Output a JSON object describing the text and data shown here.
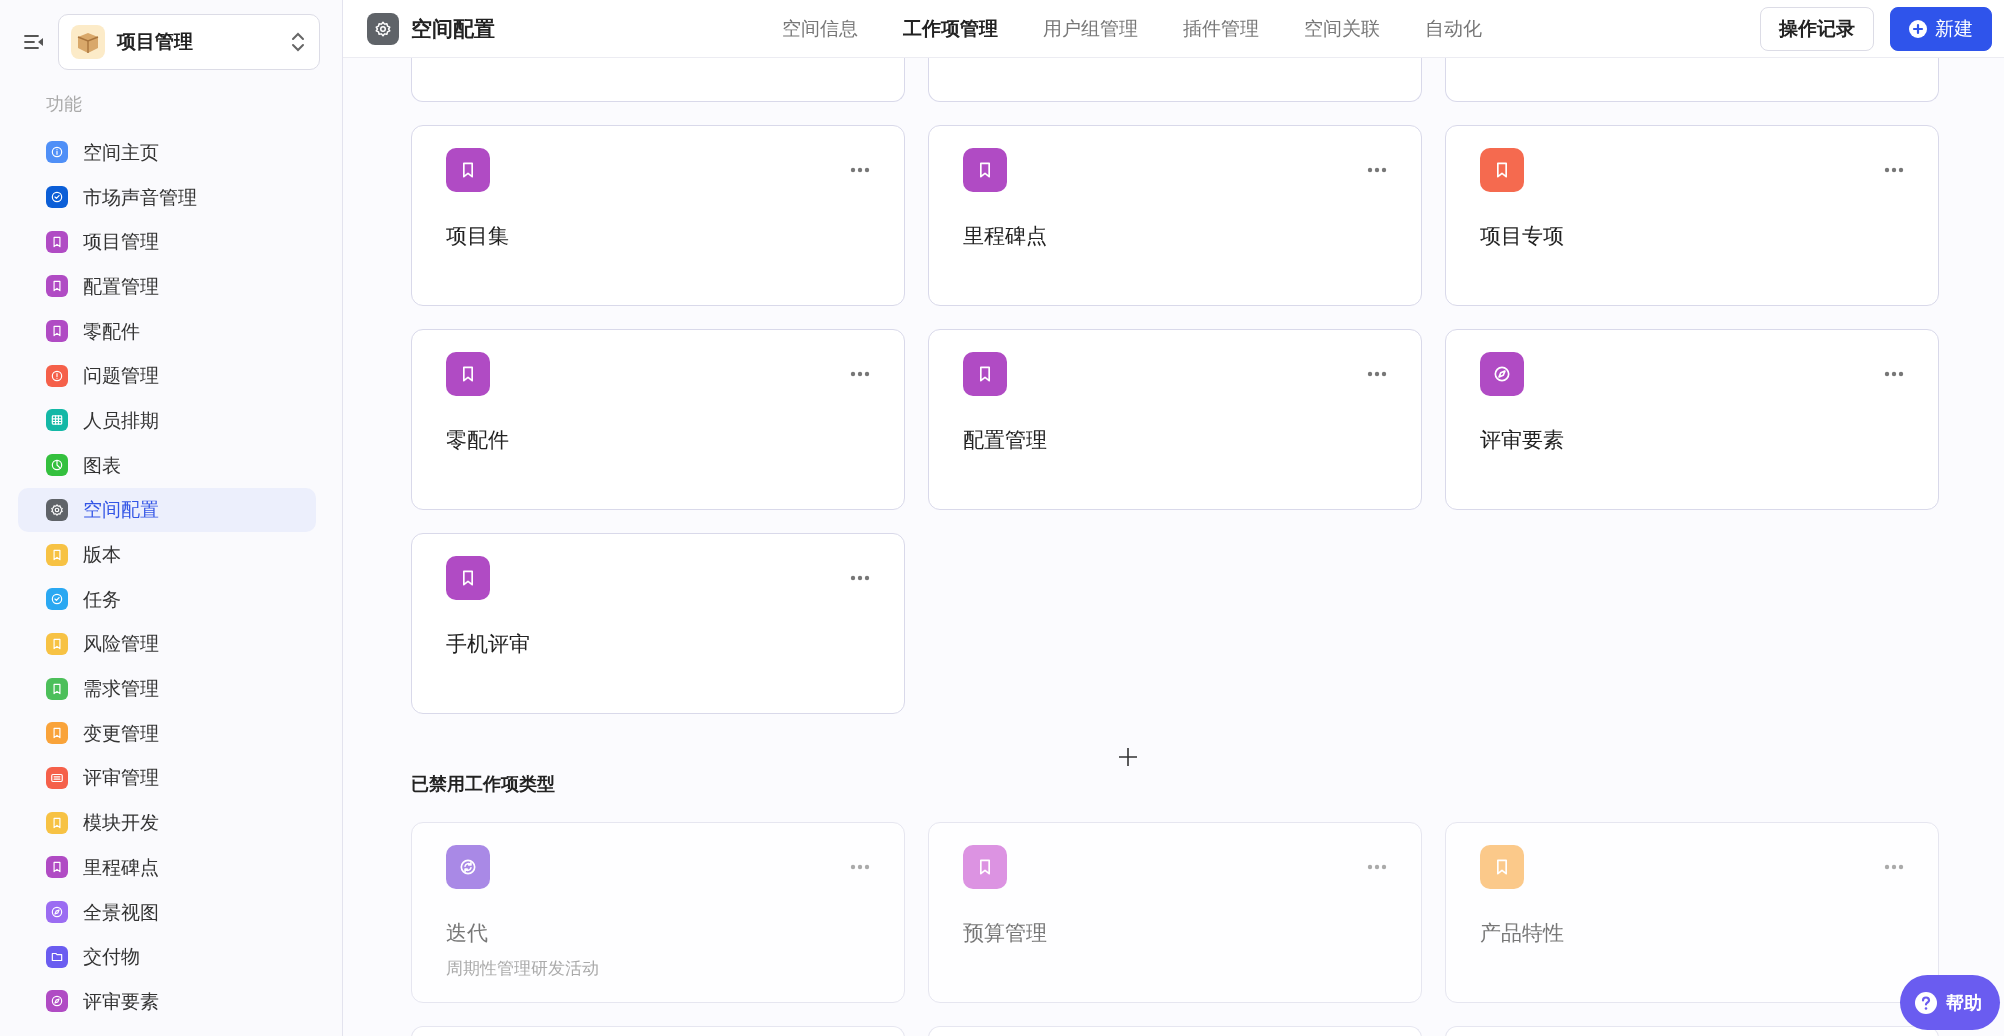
{
  "sidebar": {
    "space": {
      "name": "项目管理"
    },
    "section_label": "功能",
    "items": [
      {
        "label": "空间主页",
        "kind": "info",
        "color": "#4f8ff7",
        "selected": false
      },
      {
        "label": "市场声音管理",
        "kind": "check",
        "color": "#0b5ed7",
        "selected": false
      },
      {
        "label": "项目管理",
        "kind": "bookmark",
        "color": "#b04bc4",
        "selected": false
      },
      {
        "label": "配置管理",
        "kind": "bookmark",
        "color": "#b04bc4",
        "selected": false
      },
      {
        "label": "零配件",
        "kind": "bookmark",
        "color": "#b04bc4",
        "selected": false
      },
      {
        "label": "问题管理",
        "kind": "alert",
        "color": "#f5604a",
        "selected": false
      },
      {
        "label": "人员排期",
        "kind": "table",
        "color": "#14b8a6",
        "selected": false
      },
      {
        "label": "图表",
        "kind": "pie",
        "color": "#34c03e",
        "selected": false
      },
      {
        "label": "空间配置",
        "kind": "gear",
        "color": "#5f6368",
        "selected": true
      },
      {
        "label": "版本",
        "kind": "bookmark",
        "color": "#f7c244",
        "selected": false
      },
      {
        "label": "任务",
        "kind": "check",
        "color": "#2aa8f2",
        "selected": false
      },
      {
        "label": "风险管理",
        "kind": "bookmark",
        "color": "#f7c244",
        "selected": false
      },
      {
        "label": "需求管理",
        "kind": "bookmark",
        "color": "#4cbf5a",
        "selected": false
      },
      {
        "label": "变更管理",
        "kind": "bookmark",
        "color": "#f9a33a",
        "selected": false
      },
      {
        "label": "评审管理",
        "kind": "keyboard",
        "color": "#f5604a",
        "selected": false
      },
      {
        "label": "模块开发",
        "kind": "bookmark",
        "color": "#f7c244",
        "selected": false
      },
      {
        "label": "里程碑点",
        "kind": "bookmark",
        "color": "#b04bc4",
        "selected": false
      },
      {
        "label": "全景视图",
        "kind": "compass",
        "color": "#9b6cf2",
        "selected": false
      },
      {
        "label": "交付物",
        "kind": "folder",
        "color": "#6a5cf0",
        "selected": false
      },
      {
        "label": "评审要素",
        "kind": "compass",
        "color": "#b04bc4",
        "selected": false
      }
    ]
  },
  "header": {
    "title": "空间配置",
    "tabs": [
      {
        "label": "空间信息",
        "selected": false
      },
      {
        "label": "工作项管理",
        "selected": true
      },
      {
        "label": "用户组管理",
        "selected": false
      },
      {
        "label": "插件管理",
        "selected": false
      },
      {
        "label": "空间关联",
        "selected": false
      },
      {
        "label": "自动化",
        "selected": false
      }
    ],
    "buttons": [
      {
        "label": "操作记录",
        "kind": "outline"
      },
      {
        "label": "新建",
        "kind": "primary"
      }
    ]
  },
  "enabled_types": [
    {
      "name": "项目集",
      "kind": "bookmark",
      "color": "#b04bc4",
      "disabled": false
    },
    {
      "name": "里程碑点",
      "kind": "bookmark",
      "color": "#b04bc4",
      "disabled": false
    },
    {
      "name": "项目专项",
      "kind": "bookmark",
      "color": "#f56a4f",
      "disabled": false
    },
    {
      "name": "零配件",
      "kind": "bookmark",
      "color": "#b04bc4",
      "disabled": false
    },
    {
      "name": "配置管理",
      "kind": "bookmark",
      "color": "#b04bc4",
      "disabled": false
    },
    {
      "name": "评审要素",
      "kind": "compass",
      "color": "#b04bc4",
      "disabled": false
    },
    {
      "name": "手机评审",
      "kind": "bookmark",
      "color": "#b04bc4",
      "disabled": false
    }
  ],
  "disabled_section": {
    "title": "已禁用工作项类型",
    "types": [
      {
        "name": "迭代",
        "description": "周期性管理研发活动",
        "kind": "cycle",
        "color": "#a989e6",
        "disabled": true
      },
      {
        "name": "预算管理",
        "kind": "bookmark",
        "color": "#dc93e2",
        "disabled": true
      },
      {
        "name": "产品特性",
        "kind": "bookmark",
        "color": "#fbc98a",
        "disabled": true
      }
    ]
  },
  "help_button": {
    "label": "帮助"
  }
}
